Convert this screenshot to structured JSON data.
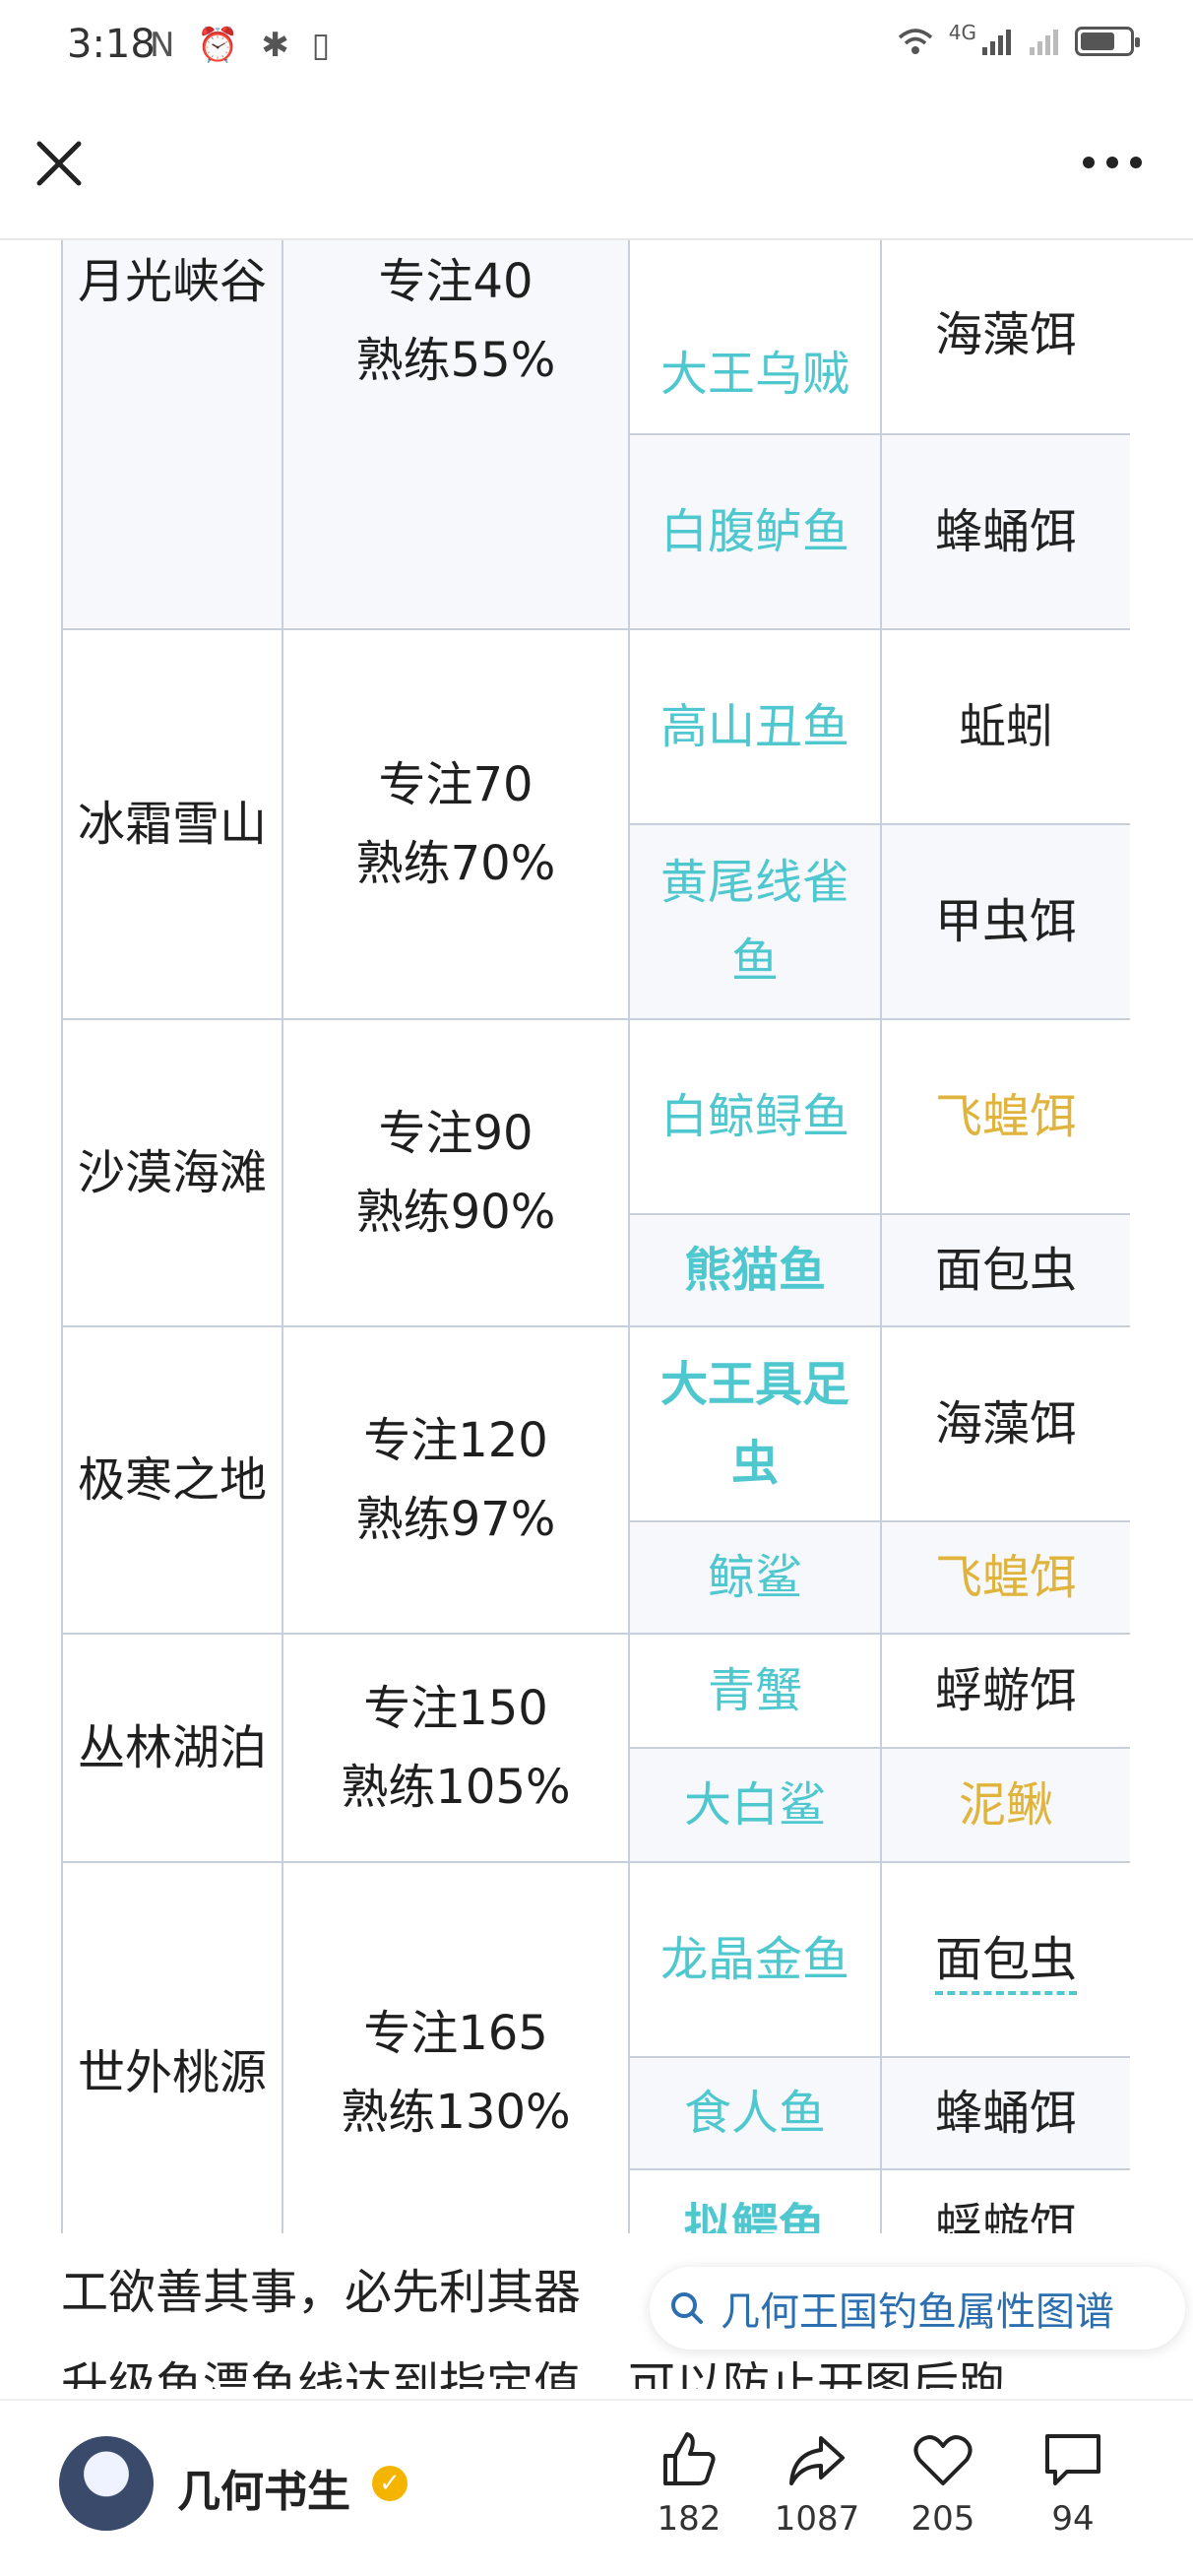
{
  "status": {
    "time": "3:18",
    "left_icons": "N ⏰ ✱ ▯",
    "network": "4G"
  },
  "table": {
    "rows": [
      {
        "region": "月光峡谷",
        "req1": "专注40",
        "req2": "熟练55%",
        "fish": [
          {
            "name": "大王乌贼",
            "bait": "海藻饵"
          },
          {
            "name": "白腹鲈鱼",
            "bait": "蜂蛹饵"
          }
        ]
      },
      {
        "region": "冰霜雪山",
        "req1": "专注70",
        "req2": "熟练70%",
        "fish": [
          {
            "name": "高山丑鱼",
            "bait": "蚯蚓"
          },
          {
            "name": "黄尾线雀鱼",
            "bait": "甲虫饵"
          }
        ]
      },
      {
        "region": "沙漠海滩",
        "req1": "专注90",
        "req2": "熟练90%",
        "fish": [
          {
            "name": "白鲸鲟鱼",
            "bait": "飞蝗饵"
          },
          {
            "name": "熊猫鱼",
            "bait": "面包虫"
          }
        ]
      },
      {
        "region": "极寒之地",
        "req1": "专注120",
        "req2": "熟练97%",
        "fish": [
          {
            "name": "大王具足虫",
            "bait": "海藻饵"
          },
          {
            "name": "鲸鲨",
            "bait": "飞蝗饵"
          }
        ]
      },
      {
        "region": "丛林湖泊",
        "req1": "专注150",
        "req2": "熟练105%",
        "fish": [
          {
            "name": "青蟹",
            "bait": "蜉蝣饵"
          },
          {
            "name": "大白鲨",
            "bait": "泥鳅"
          }
        ]
      },
      {
        "region": "世外桃源",
        "req1": "专注165",
        "req2": "熟练130%",
        "fish": [
          {
            "name": "龙晶金鱼",
            "bait": "面包虫"
          },
          {
            "name": "食人鱼",
            "bait": "蜂蛹饵"
          },
          {
            "name": "拟鳄龟",
            "bait": "蜉蝣饵"
          }
        ]
      }
    ]
  },
  "article": {
    "line1": "工欲善其事，必先利其器",
    "line2": "升级鱼漂鱼线达到指定值，可以防止开图后跑"
  },
  "search_chip": {
    "text": "几何王国钓鱼属性图谱"
  },
  "author": {
    "name": "几何书生"
  },
  "actions": {
    "like": "182",
    "share": "1087",
    "favorite": "205",
    "comment": "94"
  },
  "colors": {
    "fish": "#4fc7cf",
    "gold_bait": "#e0b43c",
    "border": "#c9cfd8"
  }
}
